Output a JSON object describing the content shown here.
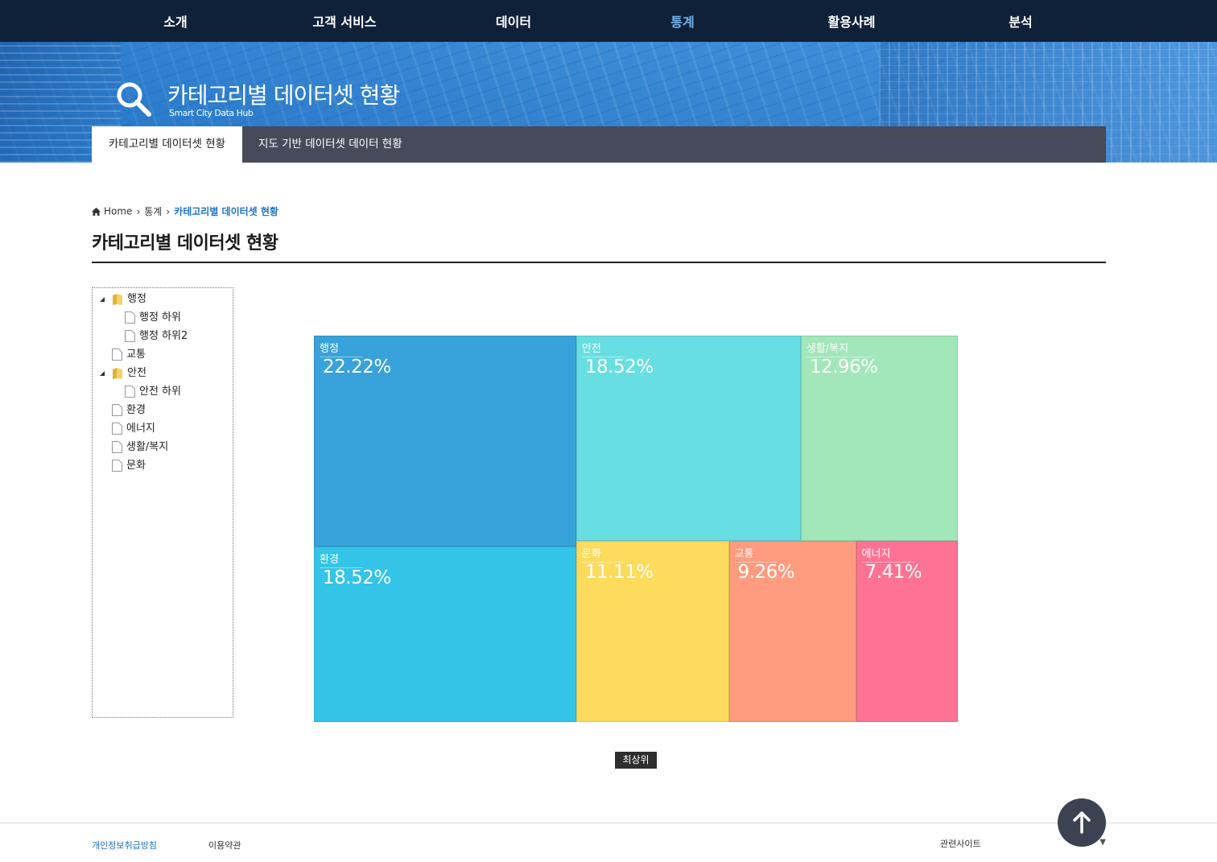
{
  "nav": {
    "items": [
      {
        "label": "소개"
      },
      {
        "label": "고객 서비스"
      },
      {
        "label": "데이터"
      },
      {
        "label": "통계"
      },
      {
        "label": "활용사례"
      },
      {
        "label": "분석"
      }
    ],
    "active": "통계"
  },
  "hero": {
    "title": "카테고리별 데이터셋 현황",
    "subtitle": "Smart City Data Hub"
  },
  "subtabs": [
    {
      "label": "카테고리별 데이터셋 현황",
      "active": true
    },
    {
      "label": "지도 기반 데이터셋 데이터 현황",
      "active": false
    }
  ],
  "breadcrumb": {
    "home": "Home",
    "section": "통계",
    "current": "카테고리별 데이터셋 현황"
  },
  "page_title": "카테고리별 데이터셋 현황",
  "tree": [
    {
      "label": "행정",
      "type": "folder",
      "expanded": true
    },
    {
      "label": "행정 하위",
      "type": "file"
    },
    {
      "label": "행정 하위2",
      "type": "file"
    },
    {
      "label": "교통",
      "type": "file"
    },
    {
      "label": "안전",
      "type": "folder",
      "expanded": true
    },
    {
      "label": "안전 하위",
      "type": "file"
    },
    {
      "label": "환경",
      "type": "file"
    },
    {
      "label": "에너지",
      "type": "file"
    },
    {
      "label": "생활/복지",
      "type": "file"
    },
    {
      "label": "문화",
      "type": "file"
    }
  ],
  "chart_data": {
    "type": "treemap",
    "unit": "%",
    "items": [
      {
        "label": "행정",
        "value": 22.22,
        "value_text": "22.22%",
        "color": "#38a2db"
      },
      {
        "label": "환경",
        "value": 18.52,
        "value_text": "18.52%",
        "color": "#33c4e8"
      },
      {
        "label": "안전",
        "value": 18.52,
        "value_text": "18.52%",
        "color": "#67dfe2"
      },
      {
        "label": "생활/복지",
        "value": 12.96,
        "value_text": "12.96%",
        "color": "#a1e7ba"
      },
      {
        "label": "문화",
        "value": 11.11,
        "value_text": "11.11%",
        "color": "#fddb5c"
      },
      {
        "label": "교통",
        "value": 9.26,
        "value_text": "9.26%",
        "color": "#ff9b7e"
      },
      {
        "label": "에너지",
        "value": 7.41,
        "value_text": "7.41%",
        "color": "#fe7393"
      }
    ]
  },
  "top_button": "최상위",
  "footer": {
    "privacy": "개인정보취급방침",
    "terms": "이용약관",
    "related": "관련사이트"
  }
}
